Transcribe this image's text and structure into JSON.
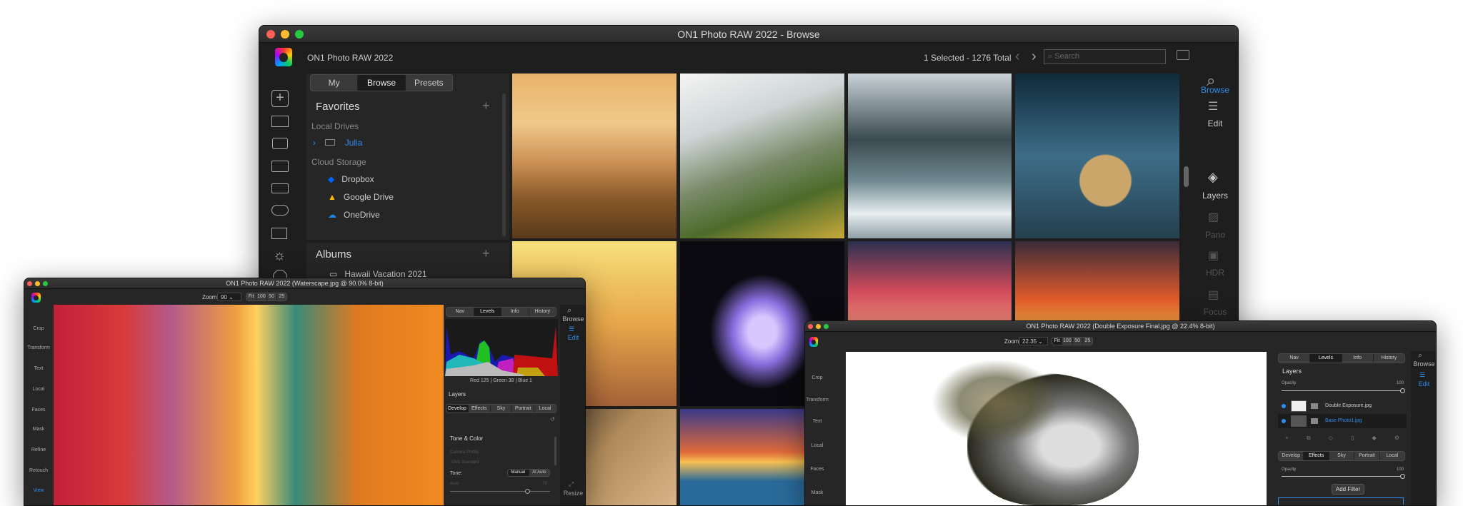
{
  "main": {
    "title": "ON1 Photo RAW 2022 - Browse",
    "app_name": "ON1 Photo RAW 2022",
    "selection_status": "1 Selected - 1276 Total",
    "search_placeholder": "Search",
    "tabs": [
      "My Catalogs",
      "Browse",
      "Presets"
    ],
    "favorites": "Favorites",
    "local_drives": "Local Drives",
    "drive": "Julia",
    "cloud_storage": "Cloud Storage",
    "cloud": [
      "Dropbox",
      "Google Drive",
      "OneDrive"
    ],
    "albums": "Albums",
    "album": "Hawaii Vacation 2021",
    "add_symbol": "+",
    "rail": [
      "Browse",
      "Edit",
      "Layers",
      "Pano",
      "HDR",
      "Focus"
    ],
    "left_icons": [
      "add-icon",
      "monitor-icon",
      "camera-icon",
      "folder-icon",
      "drive-icon",
      "cloud-icon",
      "albums-icon",
      "lightbulb-icon",
      "globe-icon"
    ]
  },
  "left_win": {
    "title": "ON1 Photo RAW 2022 (Waterscape.jpg @ 90.0% 8-bit)",
    "zoom_label": "Zoom",
    "zoom_value": "90",
    "zoom_presets": [
      "Fit",
      "100",
      "50",
      "25"
    ],
    "tools": [
      "Crop",
      "Transform",
      "Text",
      "Local",
      "Faces",
      "Mask",
      "Refine",
      "Retouch",
      "View"
    ],
    "panel_tabs": [
      "Nav",
      "Levels",
      "Info",
      "History"
    ],
    "readout": "Red 125 | Green  38  | Blue   1",
    "layers": "Layers",
    "dev_tabs": [
      "Develop",
      "Effects",
      "Sky",
      "Portrait",
      "Local"
    ],
    "section": "Tone & Color",
    "camera_profile_label": "Camera Profile:",
    "camera_profile": "ON1 Standard",
    "tone_label": "Tone:",
    "tone_modes": [
      "Manual",
      "AI Auto"
    ],
    "auto_label": "Auto",
    "auto_value": "79",
    "rail": [
      "Browse",
      "Edit",
      "Resize"
    ]
  },
  "right_win": {
    "title": "ON1 Photo RAW 2022 (Double Exposure Final.jpg @ 22.4% 8-bit)",
    "zoom_label": "Zoom",
    "zoom_value": "22.35",
    "zoom_presets": [
      "Fit",
      "100",
      "50",
      "25"
    ],
    "tools": [
      "Crop",
      "Transform",
      "Text",
      "Local",
      "Faces",
      "Mask"
    ],
    "panel_tabs": [
      "Nav",
      "Levels",
      "Info",
      "History"
    ],
    "layers": "Layers",
    "opacity_label": "Opacity",
    "opacity_value": "100",
    "layer_items": [
      "Double Exposure.jpg",
      "Base Photo1.jpg"
    ],
    "dev_tabs": [
      "Develop",
      "Effects",
      "Sky",
      "Portrait",
      "Local"
    ],
    "filter_opacity_label": "Opacity",
    "filter_opacity_value": "100",
    "add_filter": "Add Filter",
    "rail": [
      "Browse",
      "Edit"
    ]
  },
  "colors": {
    "accent": "#2d8cf0",
    "panel": "#262626",
    "close": "#fe5f57",
    "min": "#febc2e",
    "max": "#28c840"
  }
}
